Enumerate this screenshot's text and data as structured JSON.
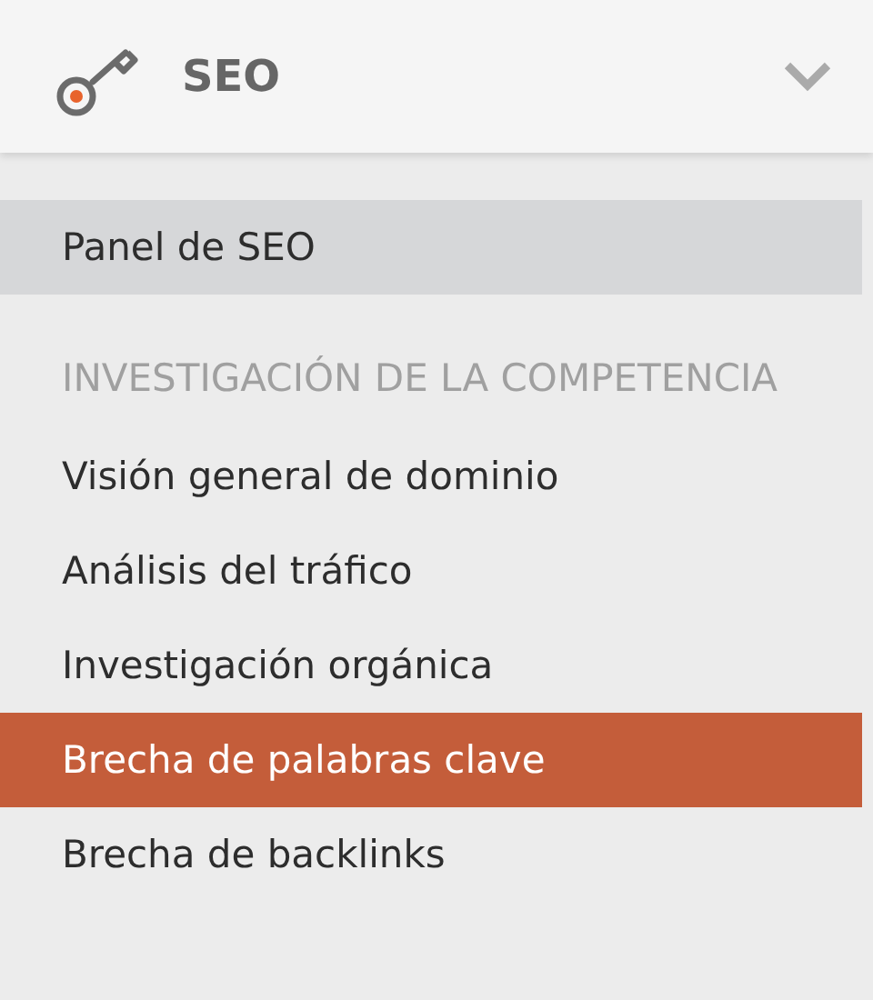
{
  "header": {
    "title": "SEO",
    "expanded": true
  },
  "menu": [
    {
      "kind": "item",
      "label": "Panel de SEO",
      "selected": false,
      "highlighted": true
    },
    {
      "kind": "heading",
      "label": "INVESTIGACIÓN DE LA COMPETENCIA"
    },
    {
      "kind": "item",
      "label": "Visión general de dominio",
      "selected": false,
      "highlighted": false
    },
    {
      "kind": "item",
      "label": "Análisis del tráfico",
      "selected": false,
      "highlighted": false
    },
    {
      "kind": "item",
      "label": "Investigación orgánica",
      "selected": false,
      "highlighted": false
    },
    {
      "kind": "item",
      "label": "Brecha de palabras clave",
      "selected": true,
      "highlighted": false
    },
    {
      "kind": "item",
      "label": "Brecha de backlinks",
      "selected": false,
      "highlighted": false
    }
  ]
}
